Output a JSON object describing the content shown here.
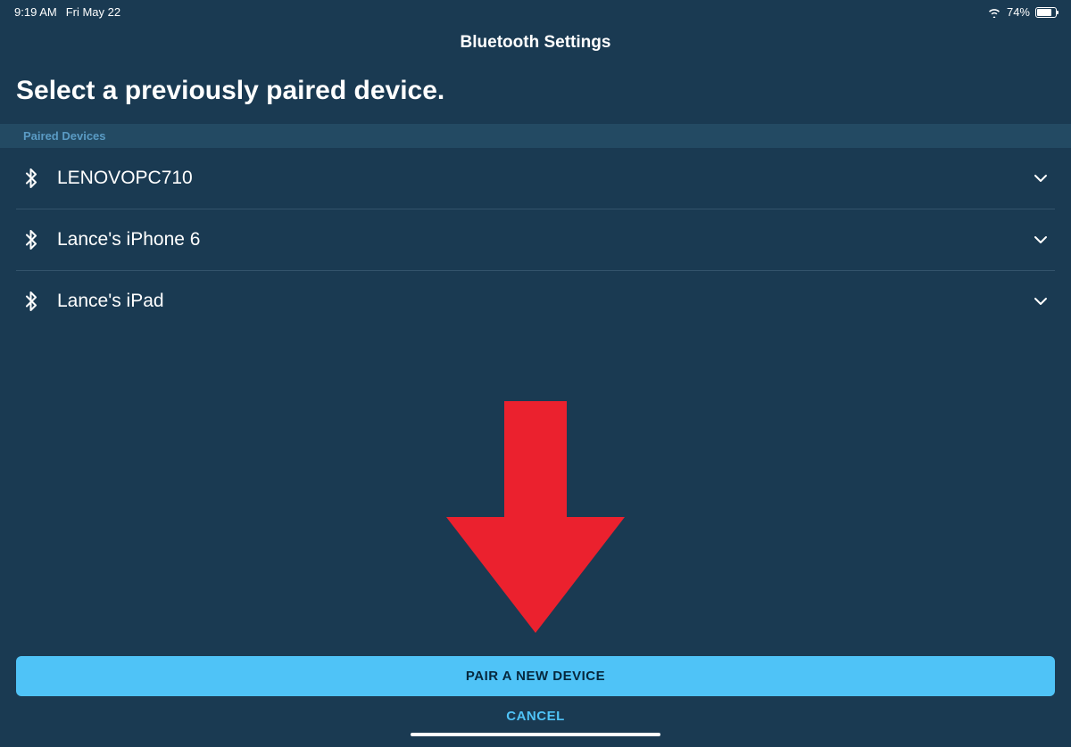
{
  "statusbar": {
    "time": "9:19 AM",
    "date": "Fri May 22",
    "battery_percent": "74%"
  },
  "header": {
    "title": "Bluetooth Settings"
  },
  "heading": "Select a previously paired device.",
  "section": {
    "label": "Paired Devices"
  },
  "devices": [
    {
      "name": "LENOVOPC710"
    },
    {
      "name": "Lance's iPhone 6"
    },
    {
      "name": "Lance's iPad"
    }
  ],
  "buttons": {
    "pair": "PAIR A NEW DEVICE",
    "cancel": "CANCEL"
  },
  "annotation": {
    "arrow_color": "#eb212e"
  }
}
